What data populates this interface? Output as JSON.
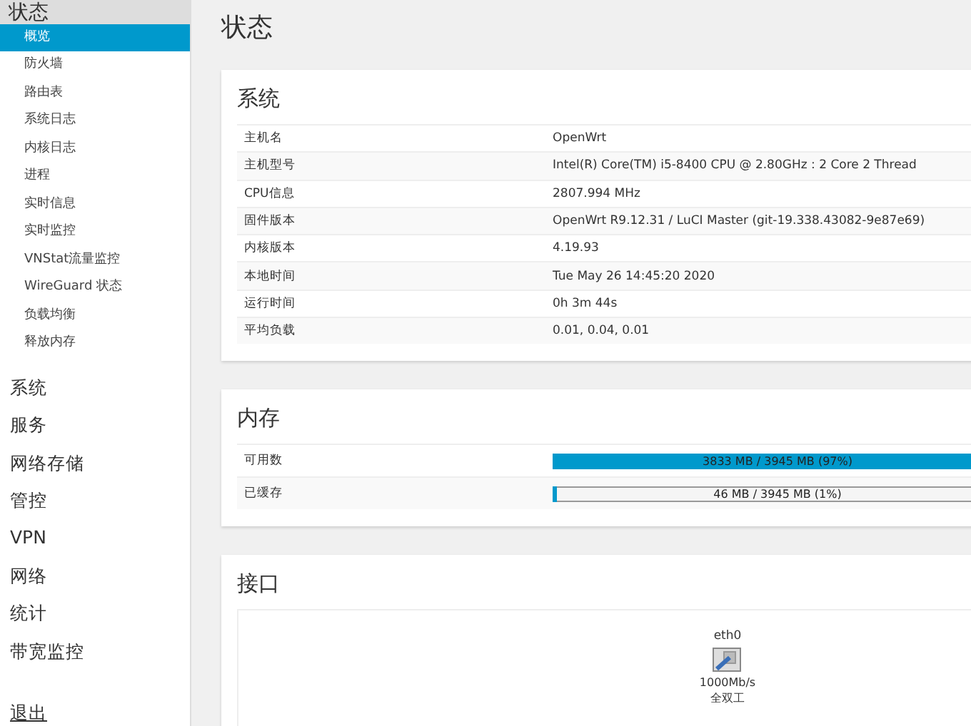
{
  "sidebar": {
    "header": "状态",
    "items": [
      {
        "label": "概览",
        "selected": true
      },
      {
        "label": "防火墙",
        "selected": false
      },
      {
        "label": "路由表",
        "selected": false
      },
      {
        "label": "系统日志",
        "selected": false
      },
      {
        "label": "内核日志",
        "selected": false
      },
      {
        "label": "进程",
        "selected": false
      },
      {
        "label": "实时信息",
        "selected": false
      },
      {
        "label": "实时监控",
        "selected": false
      },
      {
        "label": "VNStat流量监控",
        "selected": false
      },
      {
        "label": "WireGuard 状态",
        "selected": false
      },
      {
        "label": "负载均衡",
        "selected": false
      },
      {
        "label": "释放内存",
        "selected": false
      }
    ],
    "sections": [
      "系统",
      "服务",
      "网络存储",
      "管控",
      "VPN",
      "网络",
      "统计",
      "带宽监控"
    ],
    "logout": "退出"
  },
  "page_title": "状态",
  "system": {
    "title": "系统",
    "rows": [
      {
        "label": "主机名",
        "value": "OpenWrt"
      },
      {
        "label": "主机型号",
        "value": "Intel(R) Core(TM) i5-8400 CPU @ 2.80GHz : 2 Core 2 Thread"
      },
      {
        "label": "CPU信息",
        "value": "2807.994 MHz"
      },
      {
        "label": "固件版本",
        "value": "OpenWrt R9.12.31 / LuCI Master (git-19.338.43082-9e87e69)"
      },
      {
        "label": "内核版本",
        "value": "4.19.93"
      },
      {
        "label": "本地时间",
        "value": "Tue May 26 14:45:20 2020"
      },
      {
        "label": "运行时间",
        "value": "0h 3m 44s"
      },
      {
        "label": "平均负载",
        "value": "0.01, 0.04, 0.01"
      }
    ]
  },
  "memory": {
    "title": "内存",
    "rows": [
      {
        "label": "可用数",
        "level": 0.97,
        "reading": "3833 MB / 3945 MB (97%)"
      },
      {
        "label": "已缓存",
        "level": 0.01,
        "reading": "46 MB / 3945 MB (1%)"
      }
    ]
  },
  "interfaces": {
    "title": "接口",
    "ports": [
      {
        "name": "eth0",
        "speed": "1000Mb/s",
        "duplex": "全双工"
      }
    ]
  }
}
